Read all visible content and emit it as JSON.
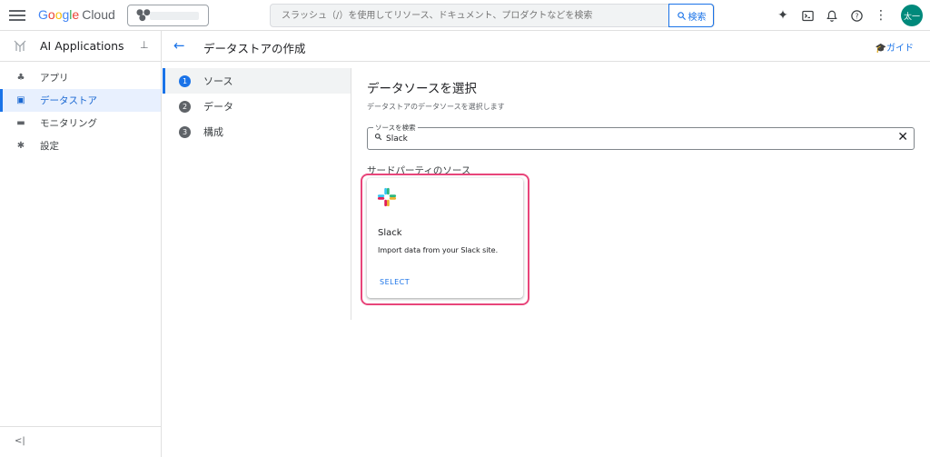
{
  "header": {
    "logo_parts": [
      "G",
      "o",
      "o",
      "g",
      "l",
      "e"
    ],
    "logo_cloud": "Cloud",
    "search_placeholder": "スラッシュ（/）を使用してリソース、ドキュメント、プロダクトなどを検索",
    "search_button": "検索",
    "avatar_text": "太一"
  },
  "sidebar": {
    "title": "AI Applications",
    "items": [
      {
        "label": "アプリ",
        "icon": "apps-icon"
      },
      {
        "label": "データストア",
        "icon": "datastore-icon"
      },
      {
        "label": "モニタリング",
        "icon": "monitoring-icon"
      },
      {
        "label": "設定",
        "icon": "gear-icon"
      }
    ],
    "collapse_label": "<|"
  },
  "page": {
    "title": "データストアの作成",
    "guide_label": "ガイド"
  },
  "steps": [
    {
      "num": "1",
      "label": "ソース"
    },
    {
      "num": "2",
      "label": "データ"
    },
    {
      "num": "3",
      "label": "構成"
    }
  ],
  "content": {
    "heading": "データソースを選択",
    "subheading": "データストアのデータソースを選択します",
    "search_label": "ソースを検索",
    "search_value": "Slack",
    "section_title": "サードパーティのソース"
  },
  "card": {
    "title": "Slack",
    "description": "Import data from your Slack site.",
    "button": "SELECT"
  },
  "colors": {
    "accent": "#1a73e8",
    "highlight": "#e8457a",
    "avatar_bg": "#00897b"
  }
}
